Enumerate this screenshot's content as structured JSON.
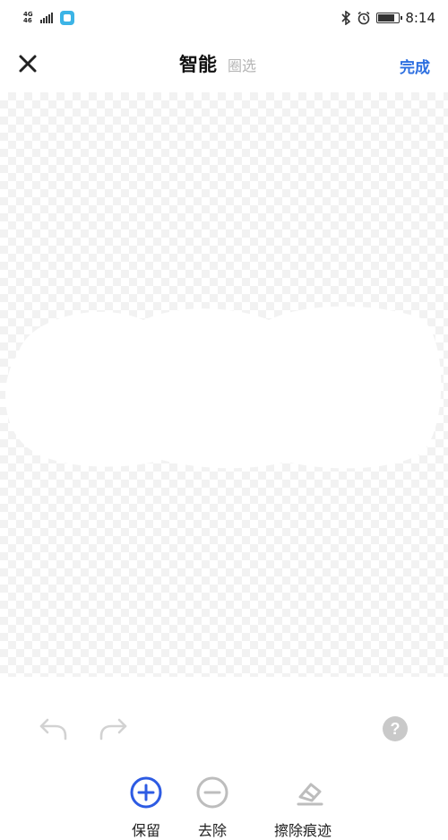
{
  "status_bar": {
    "network_type": "4G",
    "network_sub": "46",
    "time": "8:14",
    "battery_level": 0.85
  },
  "toolbar": {
    "close_icon": "close-icon",
    "mode_active": "智能",
    "mode_inactive": "圈选",
    "done_label": "完成",
    "done_color": "#2d6fe0"
  },
  "bottom": {
    "undo_icon": "undo-icon",
    "redo_icon": "redo-icon",
    "help_label": "?",
    "tools": [
      {
        "label": "保留",
        "icon": "plus-circle-icon",
        "color": "#2d5be3"
      },
      {
        "label": "去除",
        "icon": "minus-circle-icon",
        "color": "#bdbdbd"
      },
      {
        "label": "擦除痕迹",
        "icon": "eraser-icon",
        "color": "#bdbdbd"
      }
    ]
  }
}
